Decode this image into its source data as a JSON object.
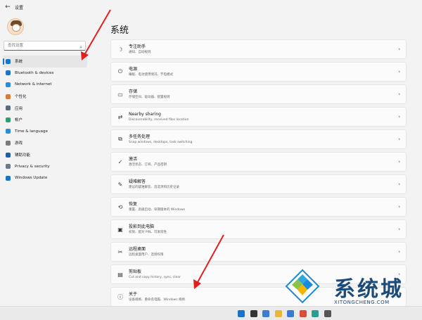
{
  "window": {
    "title": "设置",
    "back_icon": "back-arrow-icon"
  },
  "search": {
    "placeholder": "查找设置"
  },
  "nav": [
    {
      "label": "系统",
      "icon": "system-icon",
      "color": "#1a73c9",
      "active": true
    },
    {
      "label": "Bluetooth & devices",
      "icon": "bluetooth-icon",
      "color": "#1a73c9"
    },
    {
      "label": "Network & internet",
      "icon": "network-icon",
      "color": "#2a8bd8"
    },
    {
      "label": "个性化",
      "icon": "personalization-icon",
      "color": "#d87a3a"
    },
    {
      "label": "应用",
      "icon": "apps-icon",
      "color": "#5a6b7a"
    },
    {
      "label": "帐户",
      "icon": "accounts-icon",
      "color": "#2f9e6e"
    },
    {
      "label": "Time & language",
      "icon": "time-language-icon",
      "color": "#2a8bd8"
    },
    {
      "label": "游戏",
      "icon": "gaming-icon",
      "color": "#7a7a7a"
    },
    {
      "label": "辅助功能",
      "icon": "accessibility-icon",
      "color": "#1f5fa8"
    },
    {
      "label": "Privacy & security",
      "icon": "privacy-icon",
      "color": "#6b7a88"
    },
    {
      "label": "Windows Update",
      "icon": "windows-update-icon",
      "color": "#1a73c9"
    }
  ],
  "page_title": "系统",
  "cards": [
    {
      "title": "专注助手",
      "desc": "通知、自动规则",
      "icon": "focus-icon",
      "glyph": "☽"
    },
    {
      "title": "电源",
      "desc": "睡眠、电池使用情况、节电模式",
      "icon": "power-icon",
      "glyph": "⏻"
    },
    {
      "title": "存储",
      "desc": "存储空间、驱动器、配置规则",
      "icon": "storage-icon",
      "glyph": "▭"
    },
    {
      "title": "Nearby sharing",
      "desc": "Discoverability, received files location",
      "icon": "nearby-sharing-icon",
      "glyph": "⇄"
    },
    {
      "title": "多任务处理",
      "desc": "Snap windows, desktops, task switching",
      "icon": "multitasking-icon",
      "glyph": "⧉"
    },
    {
      "title": "激活",
      "desc": "激活状态、订阅、产品密钥",
      "icon": "activation-icon",
      "glyph": "✓"
    },
    {
      "title": "疑难解答",
      "desc": "建议的疑难解答、首选项和历史记录",
      "icon": "troubleshoot-icon",
      "glyph": "✎"
    },
    {
      "title": "恢复",
      "desc": "重置、高级启动、早期版本的 Windows",
      "icon": "recovery-icon",
      "glyph": "⟲"
    },
    {
      "title": "投影到此电脑",
      "desc": "权限、配对 PIN、可发现性",
      "icon": "projection-icon",
      "glyph": "▣"
    },
    {
      "title": "远程桌面",
      "desc": "远程桌面用户、连接权限",
      "icon": "remote-desktop-icon",
      "glyph": "✂"
    },
    {
      "title": "剪贴板",
      "desc": "Cut and copy history, sync, clear",
      "icon": "clipboard-icon",
      "glyph": "▤"
    },
    {
      "title": "关于",
      "desc": "设备规格、重命名电脑、Windows 规格",
      "icon": "about-icon",
      "glyph": "ⓘ"
    }
  ],
  "watermark": {
    "text": "系统城",
    "url": "XITONGCHENG.COM"
  },
  "taskbar": {
    "icons": [
      {
        "name": "start-icon",
        "color": "#1a73c9"
      },
      {
        "name": "search-icon",
        "color": "#333333"
      },
      {
        "name": "widgets-icon",
        "color": "#3a7bd5"
      },
      {
        "name": "file-explorer-icon",
        "color": "#e8b73a"
      },
      {
        "name": "store-icon",
        "color": "#3a7bd5"
      },
      {
        "name": "chrome-icon",
        "color": "#dd4b39"
      },
      {
        "name": "edge-icon",
        "color": "#2a9d8f"
      },
      {
        "name": "settings-icon",
        "color": "#555555"
      }
    ]
  }
}
